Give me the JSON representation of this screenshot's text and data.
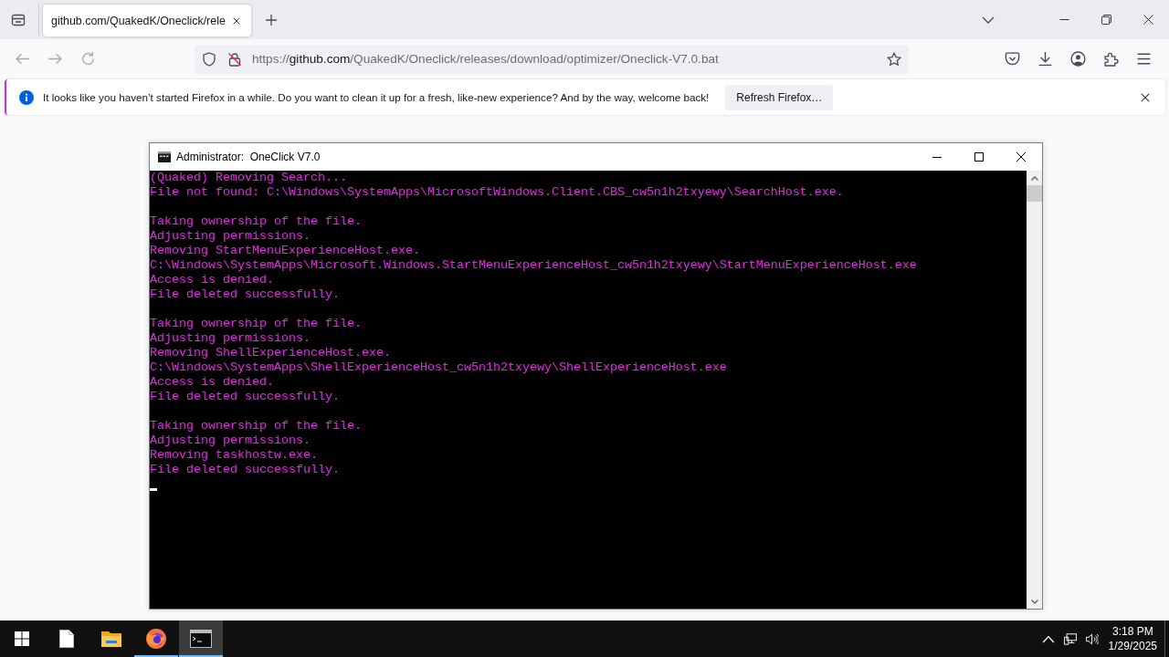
{
  "browser": {
    "tabs": [
      {
        "title": "github.com/QuakedK/Oneclick/rele",
        "selected": true
      }
    ],
    "url": {
      "scheme": "https://",
      "host": "github.com",
      "path": "/QuakedK/Oneclick/releases/download/optimizer/Oneclick-V7.0.bat"
    },
    "notification": {
      "message": "It looks like you haven’t started Firefox in a while. Do you want to clean it up for a fresh, like-new experience? And by the way, welcome back!",
      "button": "Refresh Firefox…"
    }
  },
  "console": {
    "title": "Administrator:  OneClick V7.0",
    "blocks": [
      [
        "(Quaked) Removing Search...",
        "File not found: C:\\Windows\\SystemApps\\MicrosoftWindows.Client.CBS_cw5n1h2txyewy\\SearchHost.exe."
      ],
      [
        "Taking ownership of the file.",
        "Adjusting permissions.",
        "Removing StartMenuExperienceHost.exe.",
        "C:\\Windows\\SystemApps\\Microsoft.Windows.StartMenuExperienceHost_cw5n1h2txyewy\\StartMenuExperienceHost.exe",
        "Access is denied.",
        "File deleted successfully."
      ],
      [
        "Taking ownership of the file.",
        "Adjusting permissions.",
        "Removing ShellExperienceHost.exe.",
        "C:\\Windows\\SystemApps\\ShellExperienceHost_cw5n1h2txyewy\\ShellExperienceHost.exe",
        "Access is denied.",
        "File deleted successfully."
      ],
      [
        "Taking ownership of the file.",
        "Adjusting permissions.",
        "Removing taskhostw.exe.",
        "File deleted successfully."
      ]
    ]
  },
  "taskbar": {
    "apps": [
      {
        "kind": "document",
        "running": false,
        "active": false
      },
      {
        "kind": "folder",
        "running": false,
        "active": false
      },
      {
        "kind": "browser",
        "running": true,
        "active": false
      },
      {
        "kind": "terminal",
        "running": true,
        "active": true
      }
    ],
    "clock": {
      "time": "3:18 PM",
      "date": "1/29/2025"
    }
  }
}
